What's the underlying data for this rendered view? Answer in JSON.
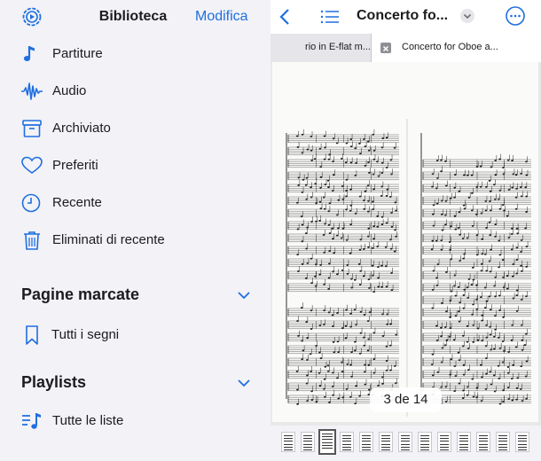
{
  "sidebar": {
    "title": "Biblioteca",
    "edit_label": "Modifica",
    "items": [
      {
        "label": "Partiture",
        "icon": "music-note-icon"
      },
      {
        "label": "Audio",
        "icon": "waveform-icon"
      },
      {
        "label": "Archiviato",
        "icon": "archive-box-icon"
      },
      {
        "label": "Preferiti",
        "icon": "heart-icon"
      },
      {
        "label": "Recente",
        "icon": "clock-icon"
      },
      {
        "label": "Eliminati di recente",
        "icon": "trash-icon"
      }
    ],
    "sections": {
      "bookmarks": {
        "title": "Pagine marcate",
        "items": [
          {
            "label": "Tutti i segni",
            "icon": "bookmark-icon"
          }
        ]
      },
      "playlists": {
        "title": "Playlists",
        "items": [
          {
            "label": "Tutte le liste",
            "icon": "playlist-icon"
          }
        ]
      }
    }
  },
  "document": {
    "title": "Concerto fo...",
    "tabs": [
      {
        "label": "rio in E-flat m...",
        "active": false
      },
      {
        "label": "Concerto for Oboe a...",
        "active": true
      }
    ],
    "page_indicator": "3 de 14",
    "thumbnail_count": 13,
    "current_thumbnail_index": 2
  },
  "colors": {
    "accent": "#1f6fe0",
    "sidebar_bg": "#f2f2f7",
    "text": "#1c1c1e"
  }
}
